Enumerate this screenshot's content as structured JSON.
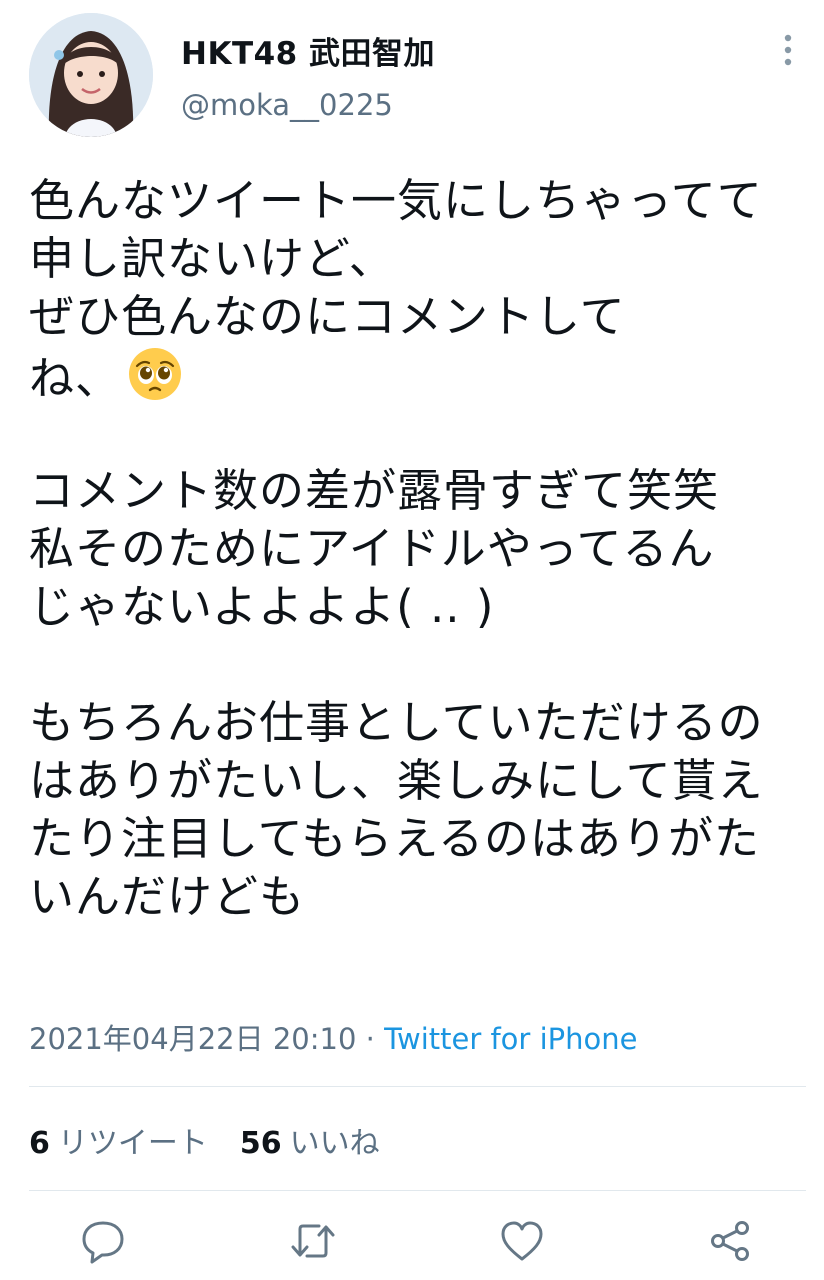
{
  "author": {
    "display_name": "HKT48 武田智加",
    "handle": "@moka__0225"
  },
  "tweet": {
    "lines": [
      "色んなツイート一気にしちゃってて",
      "申し訳ないけど、",
      "ぜひ色んなのにコメントして",
      "ね、",
      "",
      "コメント数の差が露骨すぎて笑笑",
      "私そのためにアイドルやってるん",
      "じゃないよよよよ( .. )",
      "",
      "もちろんお仕事としていただけるの",
      "はありがたいし、楽しみにして貰え",
      "たり注目してもらえるのはありがた",
      "いんだけども"
    ],
    "emoji": "pleading-face"
  },
  "meta": {
    "timestamp": "2021年04月22日 20:10",
    "separator": " · ",
    "source": "Twitter for iPhone"
  },
  "stats": {
    "retweet_count": "6",
    "retweet_label": "リツイート",
    "like_count": "56",
    "like_label": "いいね"
  },
  "actions": [
    "reply-icon",
    "retweet-icon",
    "like-icon",
    "share-icon"
  ],
  "colors": {
    "text": "#0f1419",
    "secondary": "#5b7083",
    "link": "#1b95e0",
    "divider": "#e1e8ed"
  }
}
